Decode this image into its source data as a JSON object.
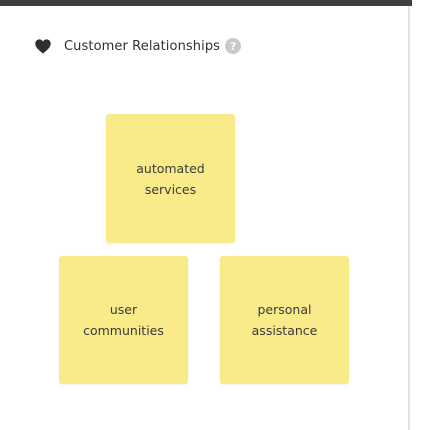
{
  "section": {
    "title": "Customer Relationships",
    "icon": "heart-icon",
    "help_icon": "help-icon",
    "help_glyph": "?"
  },
  "notes": [
    {
      "text": "automated\nservices",
      "color": "#f9ea8a"
    },
    {
      "text": "user\ncommunities",
      "color": "#f9ea8a"
    },
    {
      "text": "personal\nassistance",
      "color": "#f9ea8a"
    }
  ],
  "colors": {
    "top_bar": "#3f3f3f",
    "sticky_note": "#f9ea8a",
    "help_icon": "#c9c9c9"
  }
}
